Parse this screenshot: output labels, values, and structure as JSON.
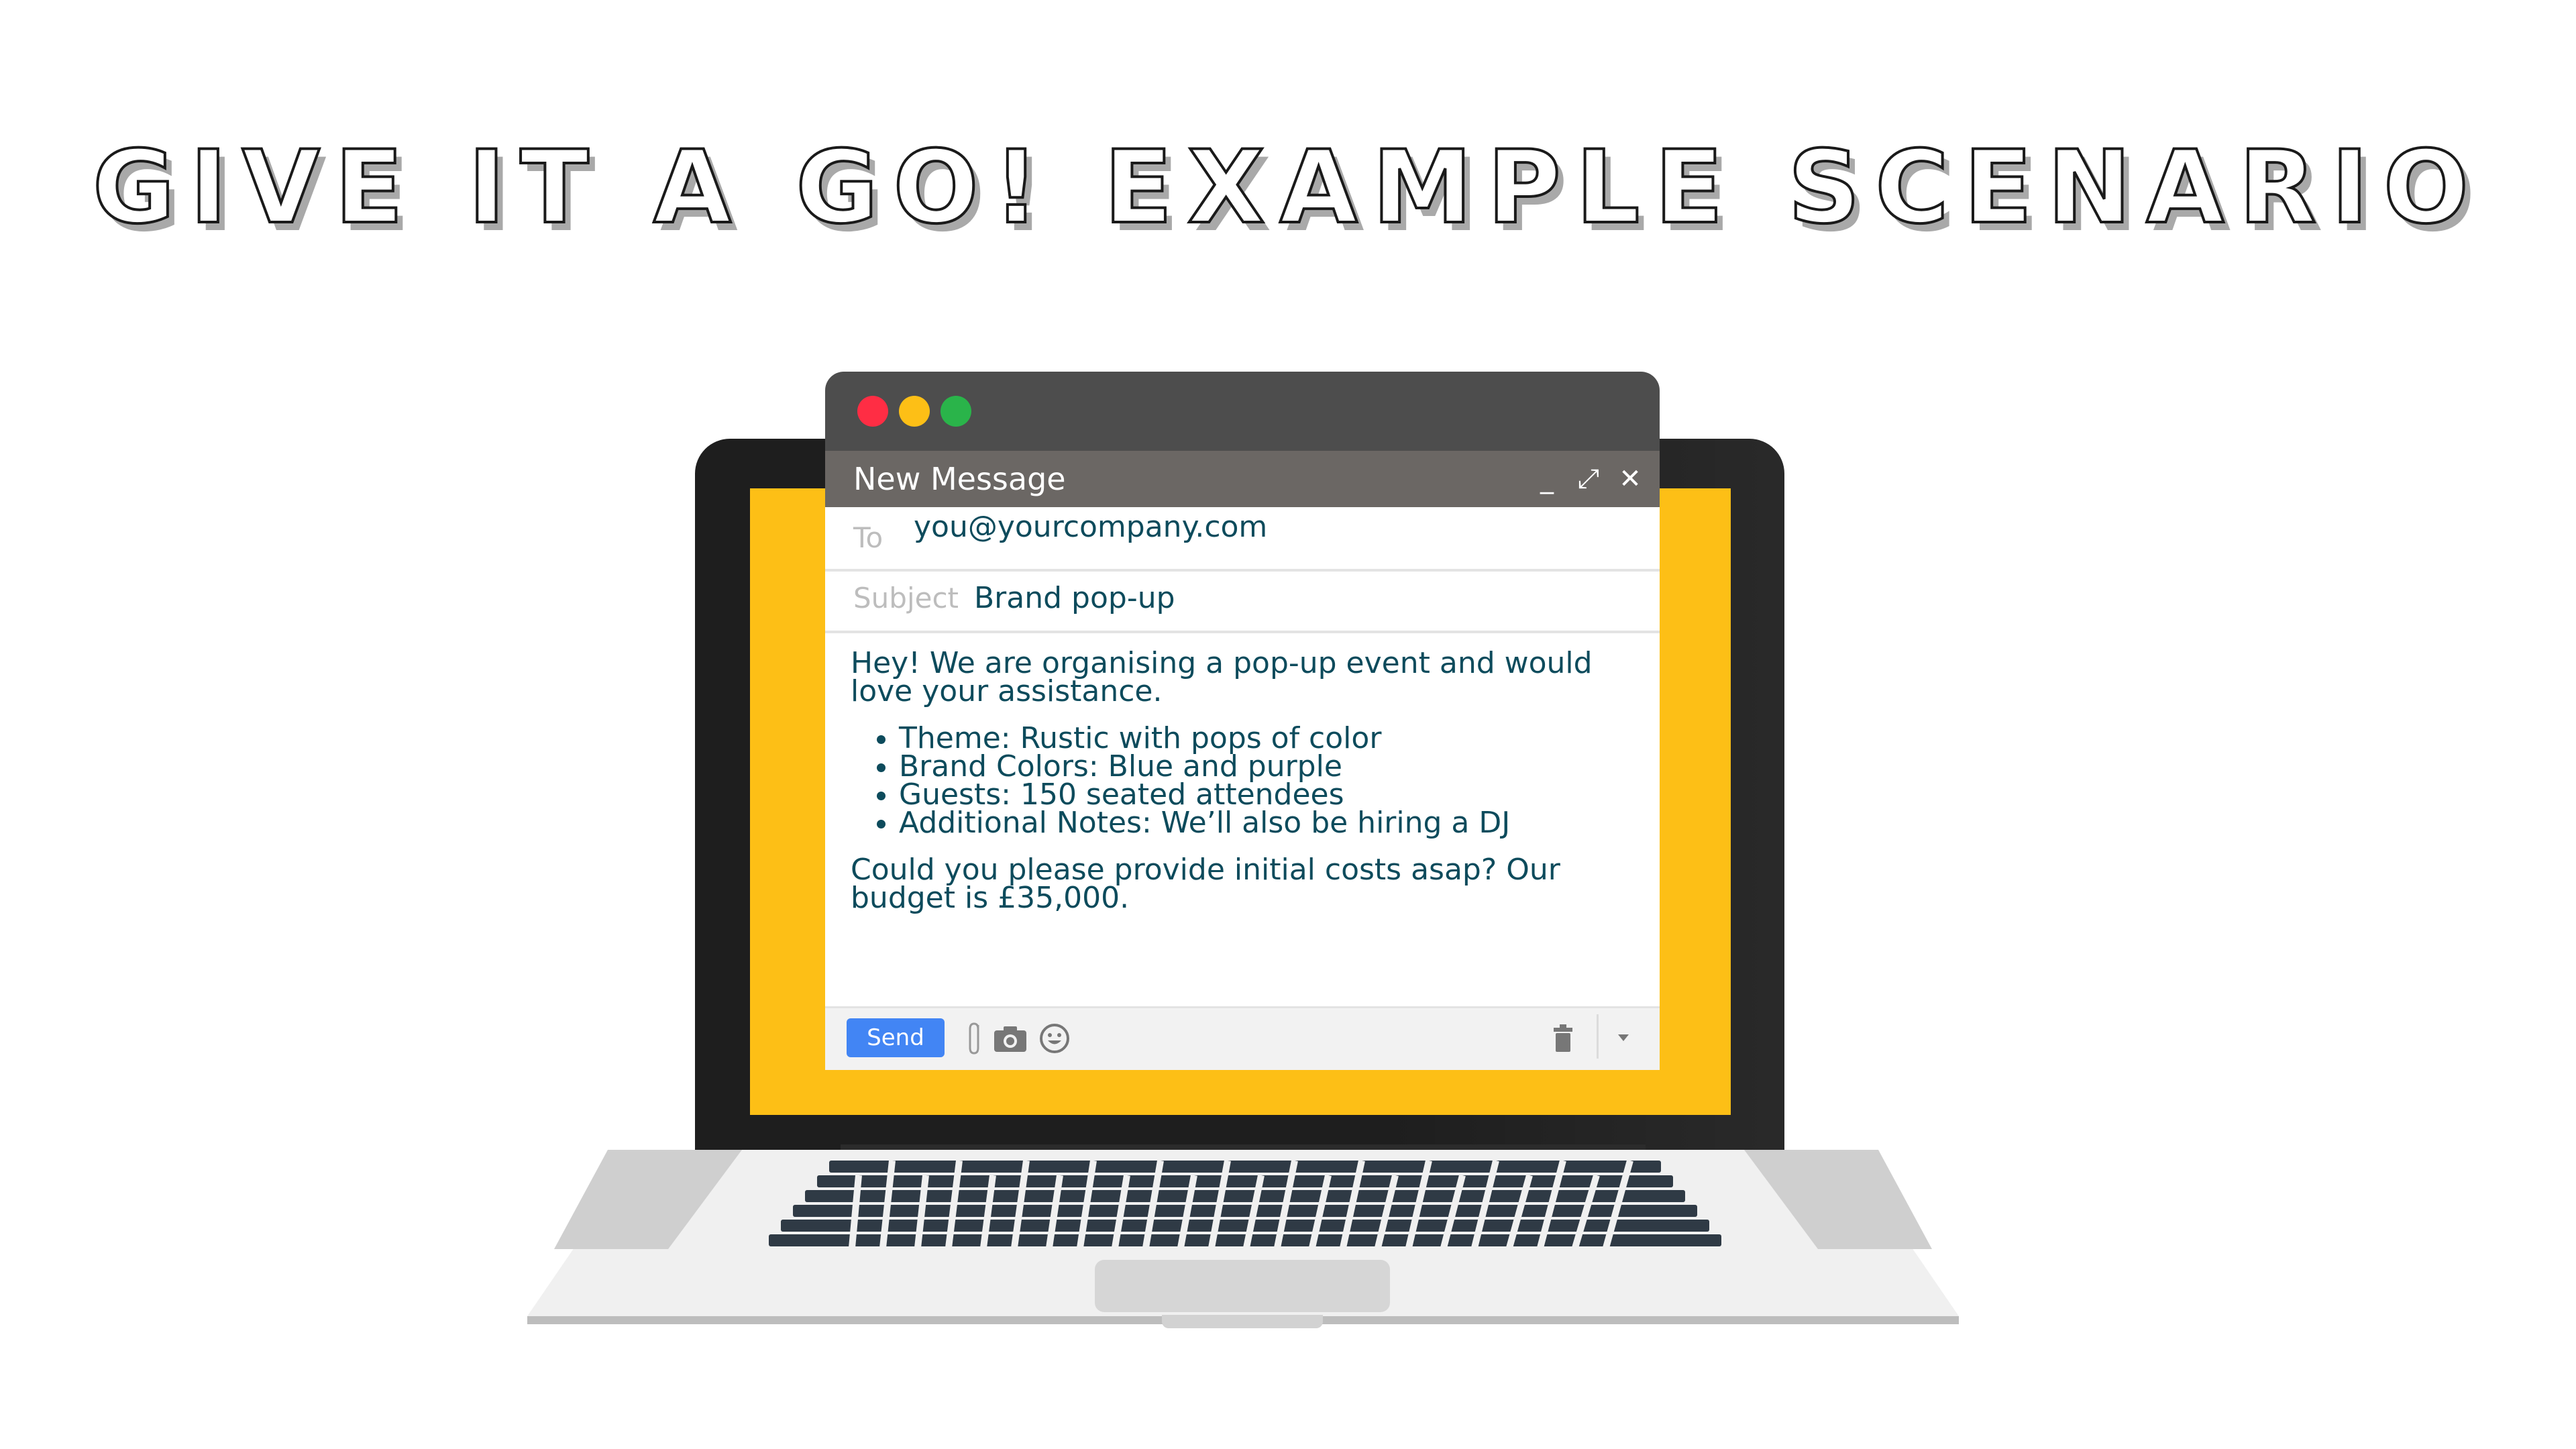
{
  "heading": {
    "title": "GIVE IT A GO! EXAMPLE SCENARIO"
  },
  "window": {
    "traffic_lights": {
      "close": "#ff2d44",
      "minimize": "#fdbf16",
      "zoom": "#2ab44a"
    },
    "title": "New Message",
    "controls": {
      "minimize": "_",
      "expand": "⤢",
      "close": "✕"
    }
  },
  "fields": {
    "to_label": "To",
    "to_value": "you@yourcompany.com",
    "subject_label": "Subject",
    "subject_value": "Brand pop-up"
  },
  "body": {
    "intro": "Hey! We are organising a pop-up event and would love your assistance.",
    "bullets": [
      "Theme: Rustic with pops of color",
      "Brand Colors: Blue and purple",
      "Guests: 150 seated attendees",
      "Additional Notes: We’ll also be hiring a DJ"
    ],
    "closing": "Could you please provide initial costs asap? Our budget is £35,000."
  },
  "toolbar": {
    "send_label": "Send",
    "icons": [
      "paperclip-icon",
      "camera-icon",
      "emoji-icon",
      "trash-icon",
      "dropdown-arrow-icon"
    ]
  },
  "colors": {
    "screen": "#fdbf16",
    "laptop_lid": "#1e1e1e",
    "text": "#0d4b5c",
    "send_button": "#4285f4"
  }
}
